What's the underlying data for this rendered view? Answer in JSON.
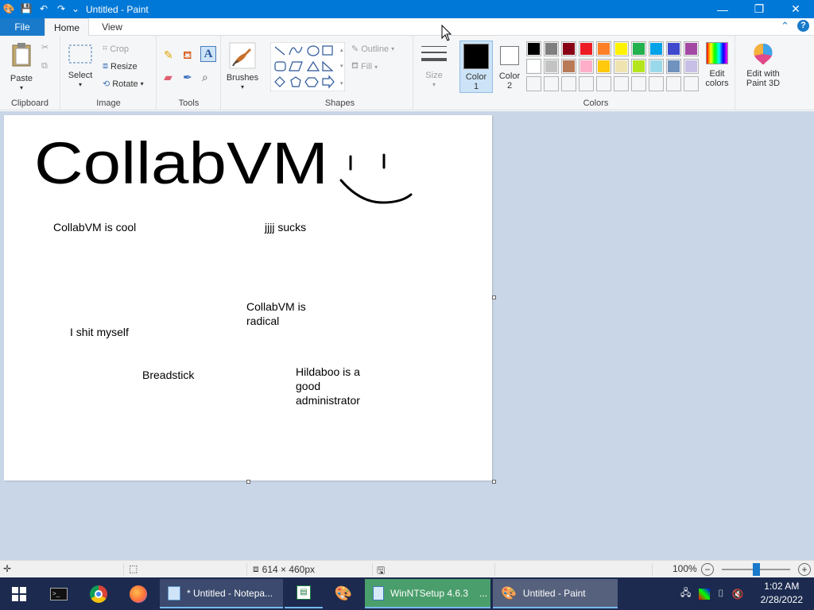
{
  "window": {
    "title": "Untitled - Paint",
    "controls": {
      "minimize": "—",
      "maximize": "❐",
      "close": "✕"
    }
  },
  "tabs": {
    "file": "File",
    "home": "Home",
    "view": "View"
  },
  "ribbon": {
    "clipboard": {
      "label": "Clipboard",
      "paste": "Paste"
    },
    "image": {
      "label": "Image",
      "select": "Select",
      "crop": "Crop",
      "resize": "Resize",
      "rotate": "Rotate"
    },
    "tools": {
      "label": "Tools"
    },
    "brushes": {
      "label": "Brushes"
    },
    "shapes": {
      "label": "Shapes",
      "outline": "Outline",
      "fill": "Fill"
    },
    "size": {
      "label": "Size"
    },
    "colors": {
      "label": "Colors",
      "color1": "Color 1",
      "color2": "Color 2",
      "edit_colors": "Edit colors",
      "edit_paint3d": "Edit with Paint 3D",
      "color1_value": "#000000",
      "color2_value": "#ffffff",
      "palette_row1": [
        "#000000",
        "#7f7f7f",
        "#880015",
        "#ed1c24",
        "#ff7f27",
        "#fff200",
        "#22b14c",
        "#00a2e8",
        "#3f48cc",
        "#a349a4"
      ],
      "palette_row2": [
        "#ffffff",
        "#c3c3c3",
        "#b97a57",
        "#ffaec9",
        "#ffc90e",
        "#efe4b0",
        "#b5e61d",
        "#99d9ea",
        "#7092be",
        "#c8bfe7"
      ]
    }
  },
  "canvas": {
    "drawing_text": "CollabVM",
    "texts": {
      "t1": "CollabVM is cool",
      "t2": "jjjj sucks",
      "t3a": "CollabVM is",
      "t3b": "radical",
      "t4": "I shit myself",
      "t5": "Breadstick",
      "t6a": "Hildaboo is a",
      "t6b": "good",
      "t6c": "administrator"
    }
  },
  "status": {
    "size": "614 × 460px",
    "zoom": "100%",
    "zoom_level": 100
  },
  "taskbar": {
    "tasks": {
      "notepad": "* Untitled - Notepa...",
      "winntsetup": "WinNTSetup 4.6.3",
      "winntsetup_more": "...",
      "paint": "Untitled - Paint"
    },
    "clock": {
      "time": "1:02 AM",
      "date": "2/28/2022"
    }
  }
}
